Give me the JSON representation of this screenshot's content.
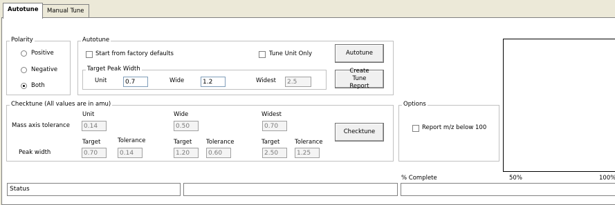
{
  "tabs": {
    "autotune": "Autotune",
    "manual": "Manual Tune"
  },
  "polarity": {
    "title": "Polarity",
    "positive": "Positive",
    "negative": "Negative",
    "both": "Both",
    "selected": "Both"
  },
  "autotune": {
    "title": "Autotune",
    "factory_defaults": "Start from factory defaults",
    "tune_unit_only": "Tune Unit Only",
    "autotune_button": "Autotune",
    "create_report_button": "Create Tune Report",
    "peak_width": {
      "title": "Target Peak Width",
      "unit_label": "Unit",
      "unit_value": "0.7",
      "wide_label": "Wide",
      "wide_value": "1.2",
      "widest_label": "Widest",
      "widest_value": "2.5"
    }
  },
  "checktune": {
    "title": "Checktune  (All values are in amu)",
    "col_unit": "Unit",
    "col_wide": "Wide",
    "col_widest": "Widest",
    "mass_axis_label": "Mass axis tolerance",
    "mass_unit": "0.14",
    "mass_wide": "0.50",
    "mass_widest": "0.70",
    "peak_width_label": "Peak width",
    "target_label": "Target",
    "tolerance_label": "Tolerance",
    "unit_target": "0.70",
    "unit_tolerance": "0.14",
    "wide_target": "1.20",
    "wide_tolerance": "0.60",
    "widest_target": "2.50",
    "widest_tolerance": "1.25",
    "checktune_button": "Checktune"
  },
  "options": {
    "title": "Options",
    "report_below_100": "Report m/z below 100"
  },
  "status": {
    "label": "Status",
    "percent_complete": "% Complete",
    "fifty": "50%",
    "hundred": "100%",
    "progress": 0
  }
}
